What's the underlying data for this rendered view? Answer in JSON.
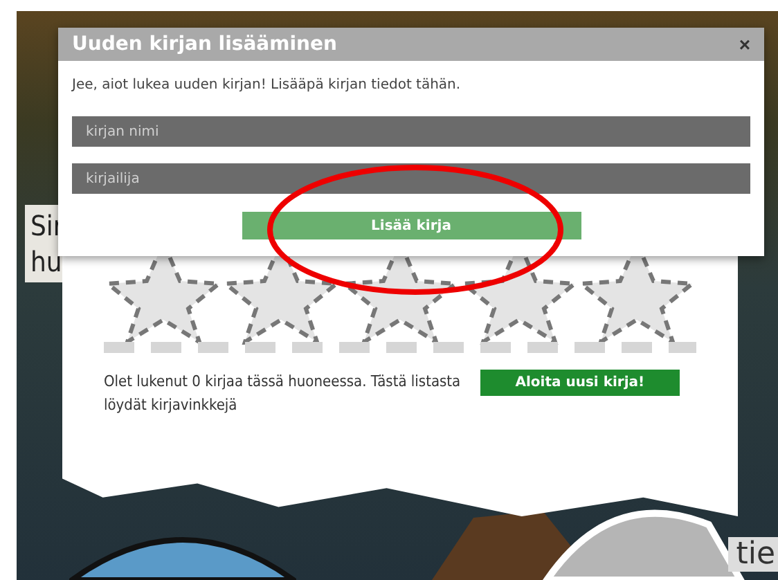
{
  "background": {
    "side_text": [
      "Sir",
      "hu"
    ],
    "corner_text": "tie"
  },
  "room": {
    "info": "Olet lukenut 0 kirjaa tässä huoneessa. Tästä listasta löydät kirjavinkkejä",
    "start_button": "Aloita uusi kirja!"
  },
  "dialog": {
    "title": "Uuden kirjan lisääminen",
    "close": "×",
    "intro": "Jee, aiot lukea uuden kirjan! Lisääpä kirjan tiedot tähän.",
    "fields": [
      {
        "placeholder": "kirjan nimi"
      },
      {
        "placeholder": "kirjailija"
      }
    ],
    "submit": "Lisää kirja"
  },
  "annotation": {
    "kind": "ellipse"
  }
}
